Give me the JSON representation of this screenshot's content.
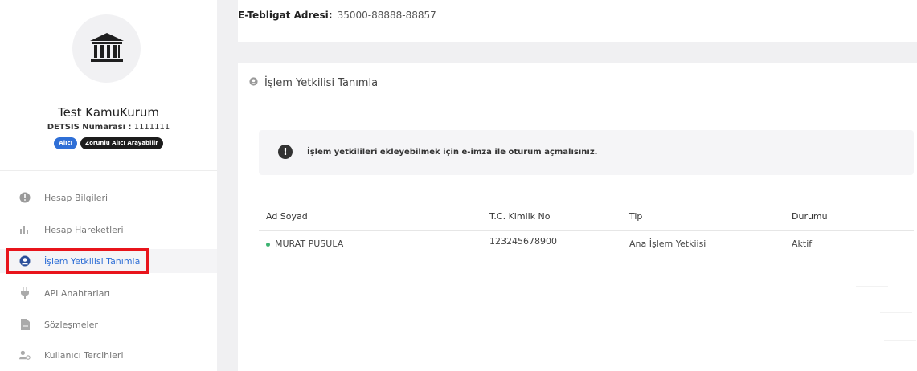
{
  "header": {
    "address_label": "E-Tebligat Adresi:",
    "address_value": "35000-88888-88857"
  },
  "profile": {
    "icon": "institution-icon",
    "name": "Test KamuKurum",
    "detsis_label": "DETSIS Numarası :",
    "detsis_value": "1111111",
    "badges": [
      "Alıcı",
      "Zorunlu Alıcı Arayabilir"
    ]
  },
  "sidebar": {
    "items": [
      {
        "label": "Hesap Bilgileri",
        "icon": "info-circle-icon"
      },
      {
        "label": "Hesap Hareketleri",
        "icon": "bar-chart-icon"
      },
      {
        "label": "İşlem Yetkilisi Tanımla",
        "icon": "user-circle-icon",
        "active": true
      },
      {
        "label": "API Anahtarları",
        "icon": "plug-icon"
      },
      {
        "label": "Sözleşmeler",
        "icon": "document-icon"
      },
      {
        "label": "Kullanıcı Tercihleri",
        "icon": "user-settings-icon"
      }
    ]
  },
  "card": {
    "title": "İşlem Yetkilisi Tanımla",
    "alert_text": "İşlem yetkilileri ekleyebilmek için e-imza ile oturum açmalısınız."
  },
  "table": {
    "columns": [
      "Ad Soyad",
      "T.C. Kimlik No",
      "Tip",
      "Durumu"
    ],
    "rows": [
      [
        "MURAT PUSULA",
        "123245678900",
        "Ana İşlem Yetkiisi",
        "Aktif"
      ]
    ]
  },
  "colors": {
    "accent": "#2f6fd6",
    "highlight": "#e8141b",
    "status_dot": "#3cb371"
  }
}
